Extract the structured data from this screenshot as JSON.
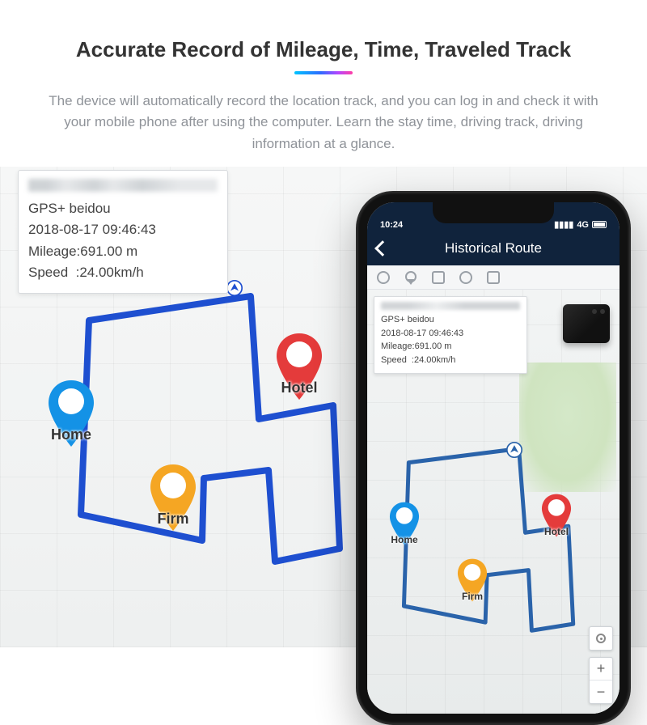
{
  "header": {
    "title": "Accurate Record of Mileage, Time, Traveled Track",
    "description": "The device will automatically record the location track, and you can log in and check it with your mobile phone after using the computer. Learn the stay time, driving track, driving information at a glance."
  },
  "info": {
    "gps_label": "GPS+ beidou",
    "timestamp": "2018-08-17 09:46:43",
    "mileage_label": "Mileage",
    "mileage_value": "691.00 m",
    "speed_label": "Speed",
    "speed_value": "24.00km/h"
  },
  "pins": {
    "home": "Home",
    "firm": "Firm",
    "hotel": "Hotel"
  },
  "phone": {
    "status_time": "10:24",
    "status_net": "4G",
    "nav_title": "Historical Route",
    "zoom_in": "+",
    "zoom_out": "−"
  },
  "colors": {
    "route": "#1e4fd0",
    "route_phone": "#2a63aa",
    "pin_home": "#1492e6",
    "pin_firm": "#f5a623",
    "pin_hotel": "#e43b3b",
    "nav_bg": "#10233c"
  }
}
